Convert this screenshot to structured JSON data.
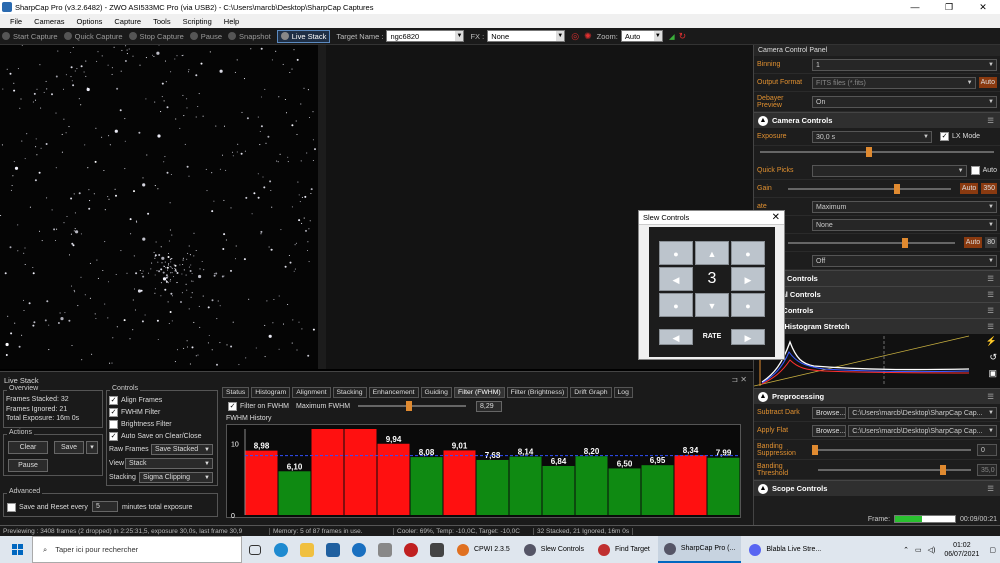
{
  "window": {
    "title": "SharpCap Pro (v3.2.6482) - ZWO ASI533MC Pro (via USB2) - C:\\Users\\marcb\\Desktop\\SharpCap Captures"
  },
  "menu": [
    "File",
    "Cameras",
    "Options",
    "Capture",
    "Tools",
    "Scripting",
    "Help"
  ],
  "toolbar": {
    "start_capture": "Start Capture",
    "quick_capture": "Quick Capture",
    "stop_capture": "Stop Capture",
    "pause": "Pause",
    "snapshot": "Snapshot",
    "live_stack": "Live Stack",
    "target_label": "Target Name :",
    "target_value": "ngc6820",
    "fx_label": "FX :",
    "fx_value": "None",
    "zoom_label": "Zoom:",
    "zoom_value": "Auto"
  },
  "right_panel": {
    "title": "Camera Control Panel",
    "binning_label": "Binning",
    "binning_value": "1",
    "output_label": "Output Format",
    "output_value": "FITS files (*.fits)",
    "output_auto": "Auto",
    "debayer_label": "Debayer\nPreview",
    "debayer_value": "On",
    "camera_controls": "Camera Controls",
    "exposure_label": "Exposure",
    "exposure_value": "30,0 s",
    "lx_mode": "LX Mode",
    "quick_picks": "Quick Picks",
    "quick_auto": "Auto",
    "gain_label": "Gain",
    "gain_auto": "Auto",
    "gain_value": "350",
    "rate_partial": "ate",
    "rate_value": "Maximum",
    "none_value": "None",
    "usb_partial": "SB",
    "usb_auto": "Auto",
    "usb_value": "80",
    "off_value": "Off",
    "image_controls": "age Controls",
    "thermal_controls": "rmal Controls",
    "misc_controls": "sc Controls",
    "histogram": "lay Histogram Stretch",
    "preprocessing": "Preprocessing",
    "subtract_dark": "Subtract Dark",
    "apply_flat": "Apply Flat",
    "browse": "Browse...",
    "dark_path": "C:\\Users\\marcb\\Desktop\\SharpCap Cap...",
    "flat_path": "C:\\Users\\marcb\\Desktop\\SharpCap Cap...",
    "banding_supp": "Banding\nSuppression",
    "banding_supp_value": "0",
    "banding_thr": "Banding\nThreshold",
    "banding_thr_value": "35,0",
    "scope_controls": "Scope Controls",
    "frame_label": "Frame:",
    "frame_time": "00:09/00:21"
  },
  "live_stack": {
    "title": "Live Stack",
    "overview": "Overview",
    "frames_stacked_label": "Frames Stacked:",
    "frames_stacked": "32",
    "frames_ignored_label": "Frames Ignored:",
    "frames_ignored": "21",
    "total_exposure_label": "Total Exposure:",
    "total_exposure": "16m 0s",
    "actions": "Actions",
    "clear": "Clear",
    "save": "Save",
    "pause": "Pause",
    "controls": "Controls",
    "align_frames": "Align Frames",
    "fwhm_filter": "FWHM Filter",
    "brightness_filter": "Brightness Filter",
    "auto_save": "Auto Save on Clear/Close",
    "raw_frames_label": "Raw Frames",
    "raw_frames_value": "Save Stacked",
    "view_label": "View",
    "view_value": "Stack",
    "stacking_label": "Stacking",
    "stacking_value": "Sigma Clipping",
    "advanced": "Advanced",
    "save_reset": "Save and Reset every",
    "save_reset_value": "5",
    "minutes": "minutes total exposure",
    "tabs": [
      "Status",
      "Histogram",
      "Alignment",
      "Stacking",
      "Enhancement",
      "Guiding",
      "Filter (FWHM)",
      "Filter (Brightness)",
      "Drift Graph",
      "Log"
    ],
    "filter_on_fwhm": "Filter on FWHM",
    "max_fwhm_label": "Maximum FWHM",
    "max_fwhm_value": "8,29",
    "fwhm_history": "FWHM History"
  },
  "chart_data": {
    "type": "bar",
    "title": "FWHM History",
    "ylim": [
      0,
      12
    ],
    "yticks": [
      "10",
      "0"
    ],
    "threshold": 8.29,
    "values": [
      8.98,
      6.1,
      12.0,
      12.0,
      9.94,
      8.08,
      9.01,
      7.68,
      8.14,
      6.84,
      8.2,
      6.5,
      6.95,
      8.34,
      7.99
    ],
    "labels": [
      "8,98",
      "6,10",
      "",
      "",
      "9,94",
      "8,08",
      "9,01",
      "7,68",
      "8,14",
      "6,84",
      "8,20",
      "6,50",
      "6,95",
      "8,34",
      "7,99"
    ],
    "colors": [
      "red",
      "green",
      "red",
      "red",
      "red",
      "green",
      "red",
      "green",
      "green",
      "green",
      "green",
      "green",
      "green",
      "red",
      "green"
    ],
    "red": "#ff1010",
    "green": "#0f8a12"
  },
  "slew": {
    "title": "Slew Controls",
    "rate_value": "3",
    "rate_label": "RATE"
  },
  "status": [
    "Previewing : 3408 frames (2 dropped) in 2:25:31,5, exposure 30,0s, last frame 30,9",
    "Memory: 5 of 87 frames in use.",
    "Cooler: 69%, Temp: -10,0C, Target: -10,0C",
    "32 Stacked, 21 Ignored, 16m 0s"
  ],
  "taskbar": {
    "search": "Taper ici pour rechercher",
    "windows": [
      "CPWI 2.3.5",
      "Slew Controls",
      "Find Target",
      "SharpCap Pro (...",
      "Blabla Live Stre..."
    ],
    "time": "01:02",
    "date": "06/07/2021"
  }
}
